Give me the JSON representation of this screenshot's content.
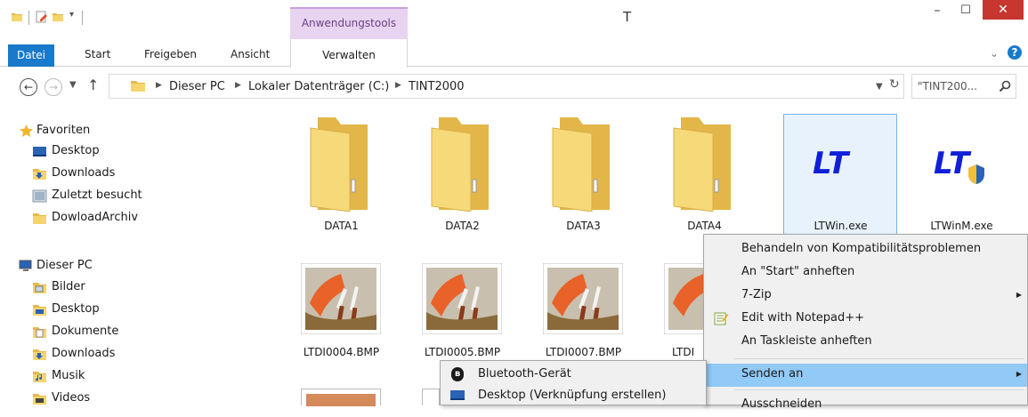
{
  "window": {
    "title": "T",
    "context_tab": "Anwendungstools",
    "controls": {
      "minimize": "–",
      "maximize": "☐",
      "close": "✕"
    }
  },
  "ribbon": {
    "tabs": [
      "Datei",
      "Start",
      "Freigeben",
      "Ansicht",
      "Verwalten"
    ],
    "help": "?"
  },
  "address": {
    "back": "←",
    "forward": "→",
    "up": "↑",
    "breadcrumbs": [
      "Dieser PC",
      "Lokaler Datenträger (C:)",
      "TINT2000"
    ],
    "search_placeholder": "\"TINT200..."
  },
  "nav_pane": {
    "favorites": {
      "header": "Favoriten",
      "items": [
        "Desktop",
        "Downloads",
        "Zuletzt besucht",
        "DowloadArchiv"
      ]
    },
    "this_pc": {
      "header": "Dieser PC",
      "items": [
        "Bilder",
        "Desktop",
        "Dokumente",
        "Downloads",
        "Musik",
        "Videos"
      ]
    }
  },
  "files": {
    "folders": [
      "DATA1",
      "DATA2",
      "DATA3",
      "DATA4"
    ],
    "executables": [
      "LTWin.exe",
      "LTWinM.exe"
    ],
    "exe_logo_text": "LT",
    "images": [
      "LTDI0004.BMP",
      "LTDI0005.BMP",
      "LTDI0007.BMP",
      "LTDI"
    ]
  },
  "context_menu": {
    "items": [
      "Behandeln von Kompatibilitätsproblemen",
      "An \"Start\" anheften",
      "7-Zip",
      "Edit with Notepad++",
      "An Taskleiste anheften",
      "Senden an",
      "Ausschneiden"
    ]
  },
  "send_to_menu": {
    "items": [
      "Bluetooth-Gerät",
      "Desktop (Verknüpfung erstellen)"
    ]
  },
  "colors": {
    "accent": "#1979ca",
    "close_red": "#c7372f",
    "context_tab_bg": "#e8d4f0",
    "menu_highlight": "#91c9f7",
    "folder_yellow": "#f5d56e"
  }
}
